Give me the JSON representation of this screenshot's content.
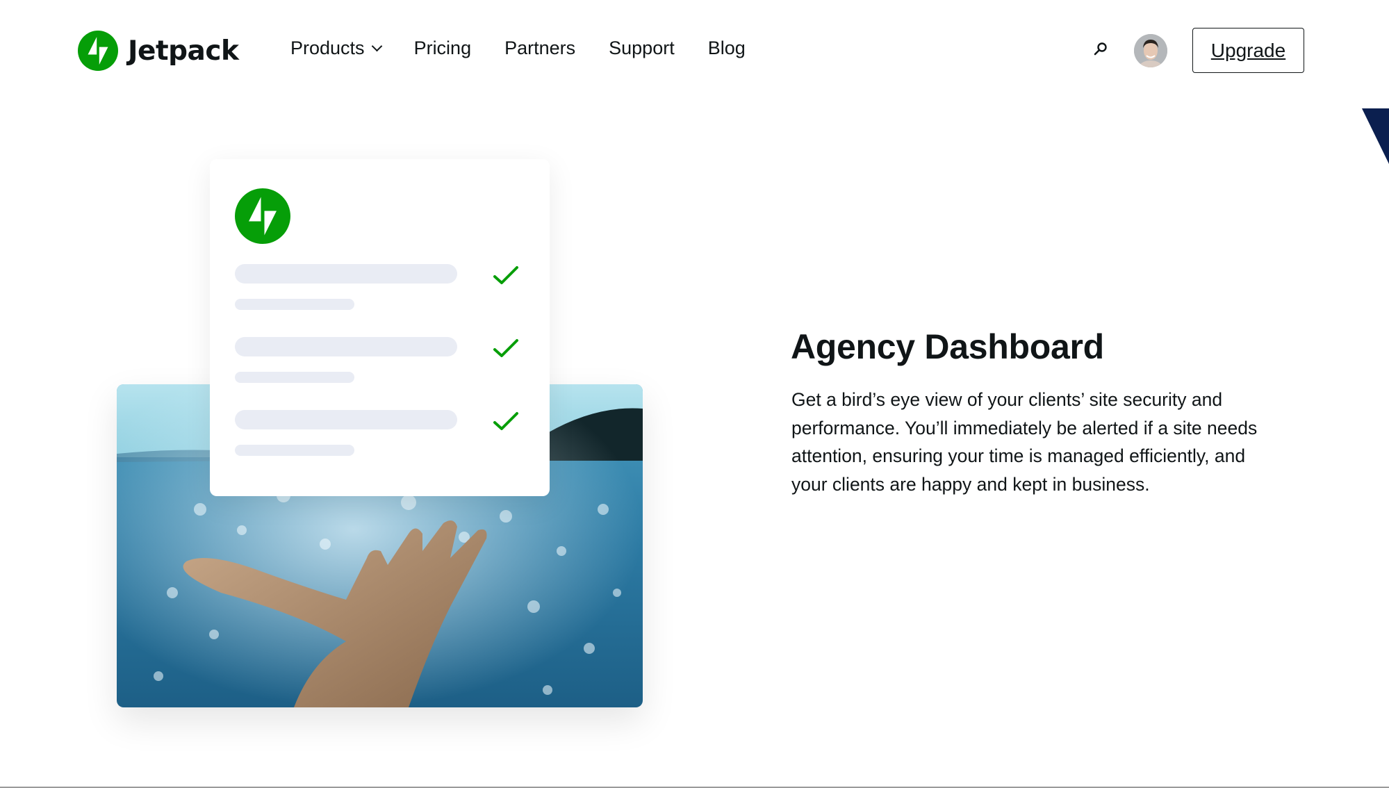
{
  "brand": {
    "name": "Jetpack",
    "accent_color": "#069E08"
  },
  "nav": {
    "items": [
      {
        "label": "Products",
        "has_dropdown": true
      },
      {
        "label": "Pricing"
      },
      {
        "label": "Partners"
      },
      {
        "label": "Support"
      },
      {
        "label": "Blog"
      }
    ],
    "search_icon": "search-icon",
    "avatar_alt": "User avatar",
    "upgrade_label": "Upgrade"
  },
  "illustration": {
    "card_rows": [
      {
        "status": "checked"
      },
      {
        "status": "checked"
      },
      {
        "status": "checked"
      }
    ],
    "check_color": "#069E08",
    "placeholder_color": "#E9ECF4",
    "photo_description": "Open hand reaching toward sparkling blue sea"
  },
  "feature": {
    "title": "Agency Dashboard",
    "description": "Get a bird’s eye view of your clients’ site security and performance. You’ll immediately be alerted if a site needs attention, ensuring your time is managed efficiently, and your clients are happy and kept in business."
  },
  "decor": {
    "corner_color": "#0B1F4F"
  }
}
